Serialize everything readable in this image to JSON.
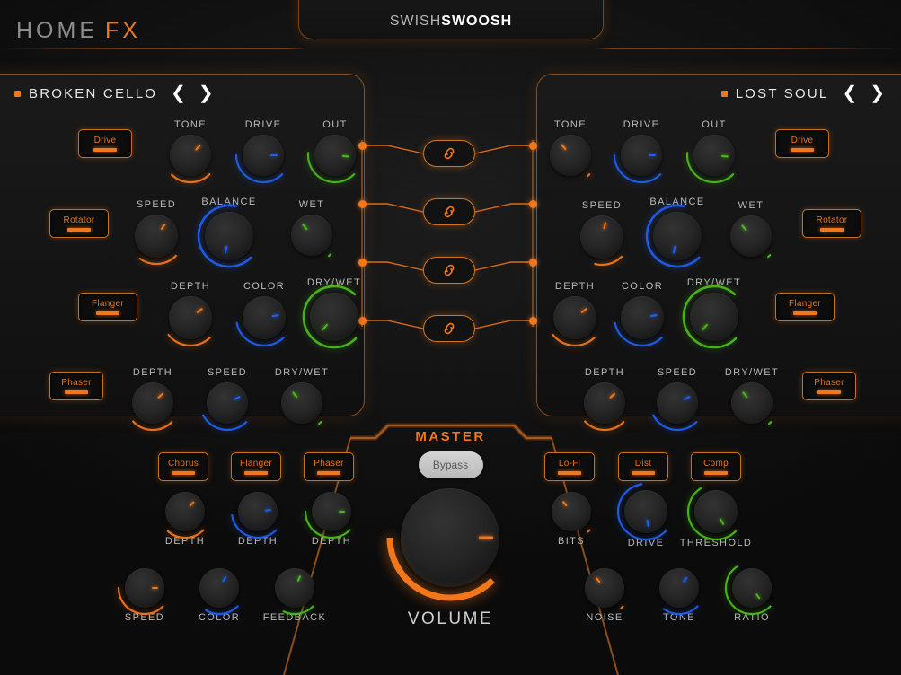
{
  "header": {
    "home_label": "HOME",
    "fx_label": "FX",
    "logo_part1": "SWISH",
    "logo_part2": "SWOOSH"
  },
  "colors": {
    "orange": "#f2761a",
    "blue": "#1f5ff0",
    "green": "#4aba18",
    "border": "#8a4e1b",
    "panel_bg": "#161616"
  },
  "panels": [
    {
      "id": "left",
      "preset_name": "BROKEN CELLO",
      "prev_icon": "chevron-left-icon",
      "next_icon": "chevron-right-icon",
      "modules": [
        {
          "label": "Drive"
        },
        {
          "label": "Rotator"
        },
        {
          "label": "Flanger"
        },
        {
          "label": "Phaser"
        }
      ],
      "knobs": [
        {
          "label": "TONE",
          "color": "orange",
          "value": 0.33,
          "size": 46
        },
        {
          "label": "DRIVE",
          "color": "blue",
          "value": 0.5,
          "size": 46
        },
        {
          "label": "OUT",
          "color": "green",
          "value": 0.52,
          "size": 46
        },
        {
          "label": "SPEED",
          "color": "orange",
          "value": 0.3,
          "size": 48
        },
        {
          "label": "BALANCE",
          "color": "blue",
          "value": 0.88,
          "size": 54
        },
        {
          "label": "WET",
          "color": "green",
          "value": 0.02,
          "size": 46
        },
        {
          "label": "DEPTH",
          "color": "orange",
          "value": 0.36,
          "size": 48
        },
        {
          "label": "COLOR",
          "color": "blue",
          "value": 0.46,
          "size": 48
        },
        {
          "label": "DRY/WET",
          "color": "green",
          "value": 0.99,
          "size": 54
        },
        {
          "label": "DEPTH",
          "color": "orange",
          "value": 0.34,
          "size": 46
        },
        {
          "label": "SPEED",
          "color": "blue",
          "value": 0.4,
          "size": 46
        },
        {
          "label": "DRY/WET",
          "color": "green",
          "value": 0.02,
          "size": 46
        }
      ]
    },
    {
      "id": "right",
      "preset_name": "LOST SOUL",
      "prev_icon": "chevron-left-icon",
      "next_icon": "chevron-right-icon",
      "modules": [
        {
          "label": "Drive"
        },
        {
          "label": "Rotator"
        },
        {
          "label": "Flanger"
        },
        {
          "label": "Phaser"
        }
      ],
      "knobs": [
        {
          "label": "TONE",
          "color": "orange",
          "value": 0.02,
          "size": 46
        },
        {
          "label": "DRIVE",
          "color": "blue",
          "value": 0.5,
          "size": 46
        },
        {
          "label": "OUT",
          "color": "green",
          "value": 0.52,
          "size": 46
        },
        {
          "label": "SPEED",
          "color": "orange",
          "value": 0.22,
          "size": 48
        },
        {
          "label": "BALANCE",
          "color": "blue",
          "value": 0.88,
          "size": 54
        },
        {
          "label": "WET",
          "color": "green",
          "value": 0.02,
          "size": 46
        },
        {
          "label": "DEPTH",
          "color": "orange",
          "value": 0.36,
          "size": 48
        },
        {
          "label": "COLOR",
          "color": "blue",
          "value": 0.46,
          "size": 48
        },
        {
          "label": "DRY/WET",
          "color": "green",
          "value": 0.99,
          "size": 54
        },
        {
          "label": "DEPTH",
          "color": "orange",
          "value": 0.34,
          "size": 46
        },
        {
          "label": "SPEED",
          "color": "blue",
          "value": 0.4,
          "size": 46
        },
        {
          "label": "DRY/WET",
          "color": "green",
          "value": 0.02,
          "size": 46
        }
      ]
    }
  ],
  "links": [
    {
      "icon": "chain-link-icon",
      "label": "link-1"
    },
    {
      "icon": "chain-link-icon",
      "label": "link-2"
    },
    {
      "icon": "chain-link-icon",
      "label": "link-3"
    },
    {
      "icon": "chain-link-icon",
      "label": "link-4"
    }
  ],
  "master": {
    "title": "MASTER",
    "bypass_label": "Bypass",
    "volume_label": "VOLUME",
    "volume_value": 0.5,
    "left_modules": [
      {
        "label": "Chorus"
      },
      {
        "label": "Flanger"
      },
      {
        "label": "Phaser"
      }
    ],
    "right_modules": [
      {
        "label": "Lo-Fi"
      },
      {
        "label": "Dist"
      },
      {
        "label": "Comp"
      }
    ],
    "left_knobs": [
      {
        "label": "DEPTH",
        "color": "orange",
        "value": 0.32,
        "size": 44
      },
      {
        "label": "DEPTH",
        "color": "blue",
        "value": 0.47,
        "size": 44
      },
      {
        "label": "DEPTH",
        "color": "green",
        "value": 0.5,
        "size": 44
      },
      {
        "label": "SPEED",
        "color": "orange",
        "value": 0.5,
        "size": 44
      },
      {
        "label": "COLOR",
        "color": "blue",
        "value": 0.28,
        "size": 44
      },
      {
        "label": "FEEDBACK",
        "color": "green",
        "value": 0.26,
        "size": 44
      }
    ],
    "right_knobs": [
      {
        "label": "BITS",
        "color": "orange",
        "value": 0.02,
        "size": 44
      },
      {
        "label": "DRIVE",
        "color": "blue",
        "value": 0.8,
        "size": 48
      },
      {
        "label": "THRESHOLD",
        "color": "green",
        "value": 0.72,
        "size": 48
      },
      {
        "label": "NOISE",
        "color": "orange",
        "value": 0.02,
        "size": 44
      },
      {
        "label": "TONE",
        "color": "blue",
        "value": 0.3,
        "size": 44
      },
      {
        "label": "RATIO",
        "color": "green",
        "value": 0.7,
        "size": 44
      }
    ]
  }
}
